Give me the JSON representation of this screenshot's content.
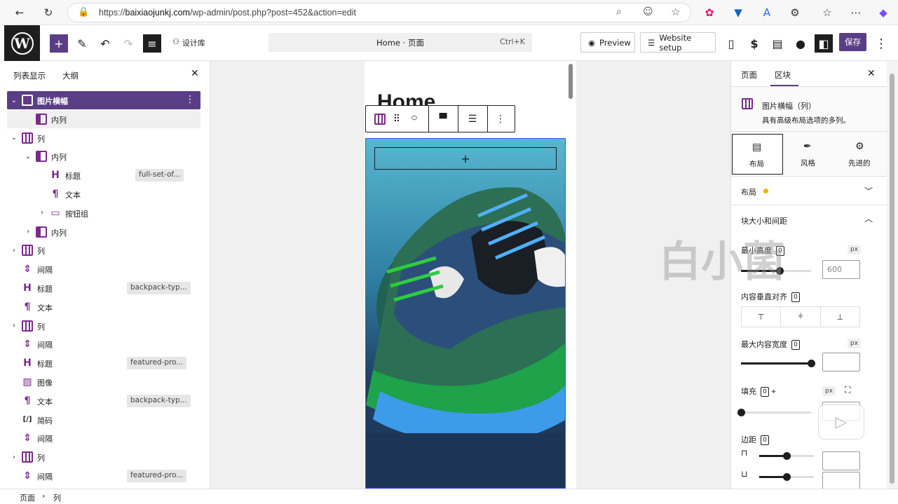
{
  "browser": {
    "url_prefix": "https://",
    "url_host": "baixiaojunkj.com",
    "url_path": "/wp-admin/post.php?post=452&action=edit"
  },
  "toolbar": {
    "patterns_label": "设计库",
    "command_title": "Home · 页面",
    "command_shortcut": "Ctrl+K",
    "preview_label": "Preview",
    "website_setup_label": "Website setup",
    "save_label": "保存"
  },
  "left_panel": {
    "tabs": [
      "列表显示",
      "大纲"
    ],
    "items": [
      {
        "label": "图片横幅",
        "icon": "cover",
        "level": 0,
        "expand": "down",
        "selected": true
      },
      {
        "label": "内列",
        "icon": "inner-column",
        "level": 1,
        "expand": "",
        "hover": true
      },
      {
        "label": "列",
        "icon": "columns",
        "level": 0,
        "expand": "down"
      },
      {
        "label": "内列",
        "icon": "inner-column",
        "level": 1,
        "expand": "down"
      },
      {
        "label": "标题",
        "icon": "heading",
        "level": 2,
        "expand": "",
        "tag": "full-set-of..."
      },
      {
        "label": "文本",
        "icon": "paragraph",
        "level": 2,
        "expand": ""
      },
      {
        "label": "按钮组",
        "icon": "buttons",
        "level": 2,
        "expand": "right"
      },
      {
        "label": "内列",
        "icon": "inner-column",
        "level": 1,
        "expand": "right"
      },
      {
        "label": "列",
        "icon": "columns",
        "level": 0,
        "expand": "right"
      },
      {
        "label": "间隔",
        "icon": "spacer",
        "level": 0,
        "expand": ""
      },
      {
        "label": "标题",
        "icon": "heading",
        "level": 0,
        "expand": "",
        "tag": "backpack-typ..."
      },
      {
        "label": "文本",
        "icon": "paragraph",
        "level": 0,
        "expand": ""
      },
      {
        "label": "列",
        "icon": "columns",
        "level": 0,
        "expand": "right"
      },
      {
        "label": "间隔",
        "icon": "spacer",
        "level": 0,
        "expand": ""
      },
      {
        "label": "标题",
        "icon": "heading",
        "level": 0,
        "expand": "",
        "tag": "featured-pro..."
      },
      {
        "label": "图像",
        "icon": "image",
        "level": 0,
        "expand": ""
      },
      {
        "label": "文本",
        "icon": "paragraph",
        "level": 0,
        "expand": "",
        "tag": "backpack-typ..."
      },
      {
        "label": "简码",
        "icon": "shortcode",
        "level": 0,
        "expand": ""
      },
      {
        "label": "间隔",
        "icon": "spacer",
        "level": 0,
        "expand": ""
      },
      {
        "label": "列",
        "icon": "columns",
        "level": 0,
        "expand": "right"
      },
      {
        "label": "间隔",
        "icon": "spacer",
        "level": 0,
        "expand": "",
        "tag": "featured-pro..."
      }
    ]
  },
  "canvas": {
    "page_title": "Home",
    "add_block_symbol": "+"
  },
  "right_panel": {
    "tabs": [
      "页面",
      "区块"
    ],
    "block_name": "图片横幅（列）",
    "block_desc": "具有高级布局选项的多列。",
    "style_tabs": [
      "布局",
      "风格",
      "先进的"
    ],
    "layout_section": "布局",
    "size_section": "块大小和间距",
    "min_height_label": "最小高度",
    "min_height_placeholder": "600",
    "min_height_level": 0.55,
    "valign_label": "内容垂直对齐",
    "max_width_label": "最大内容宽度",
    "max_width_level": 1.0,
    "padding_label": "填充",
    "padding_level": 0.0,
    "margin_label": "边距",
    "margin_top_level": 0.5,
    "margin_bottom_level": 0.5,
    "unit": "px",
    "badge_value": "0"
  },
  "statusbar": {
    "crumbs": [
      "页面",
      "列"
    ]
  },
  "watermark": "白小菌",
  "colors": {
    "accent": "#5a3e85",
    "icon_purple": "#7b2b8c",
    "highlight": "#3858e9"
  }
}
